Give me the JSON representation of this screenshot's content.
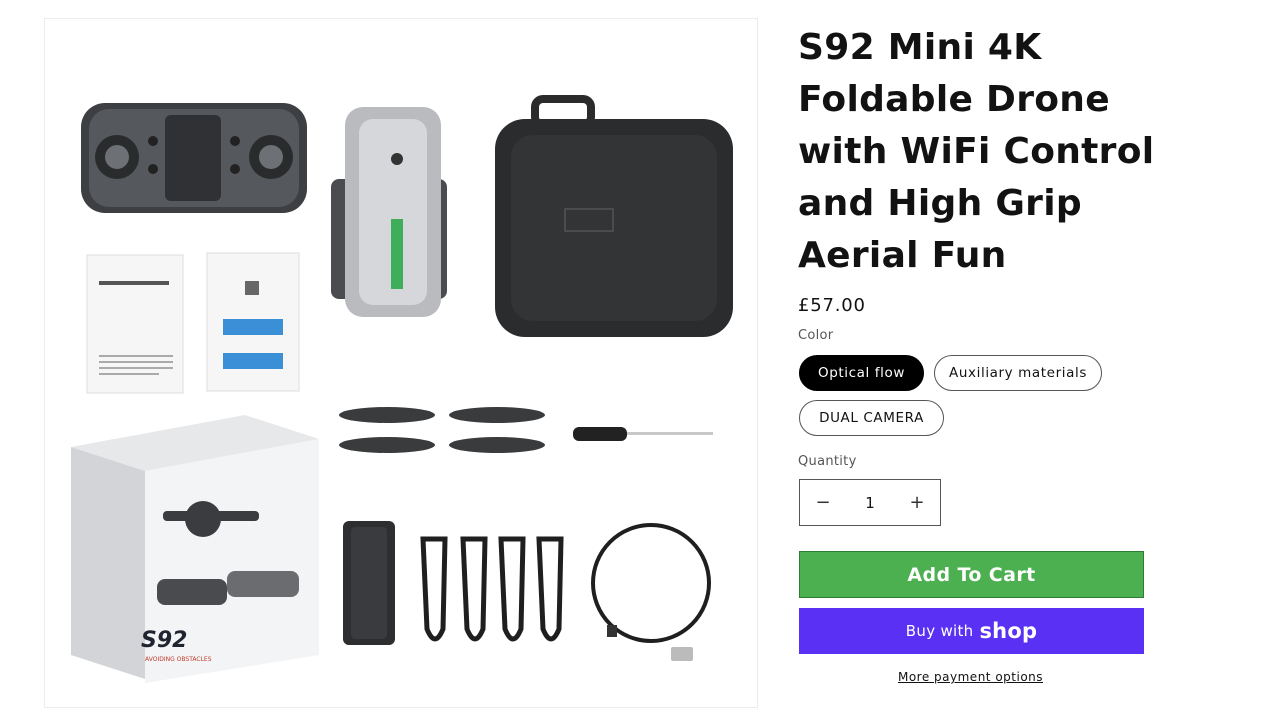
{
  "product": {
    "title": "S92 Mini 4K Foldable Drone with WiFi Control and High Grip Aerial Fun",
    "price": "£57.00",
    "image_alt": "S92 drone package contents"
  },
  "box_print": {
    "model": "S92",
    "subtitle": "AVOIDING OBSTACLES"
  },
  "color_option": {
    "label": "Color",
    "options": [
      "Optical flow",
      "Auxiliary materials",
      "DUAL CAMERA"
    ],
    "selected": "Optical flow"
  },
  "quantity": {
    "label": "Quantity",
    "value": "1",
    "decrease_icon": "minus-icon",
    "increase_icon": "plus-icon"
  },
  "actions": {
    "add_to_cart": "Add To Cart",
    "buy_with": "Buy with",
    "shop_brand": "shop",
    "more_payment": "More payment options"
  },
  "colors": {
    "add_to_cart_bg": "#4caf50",
    "shop_pay_bg": "#5a31f4",
    "selected_pill_bg": "#000000"
  }
}
